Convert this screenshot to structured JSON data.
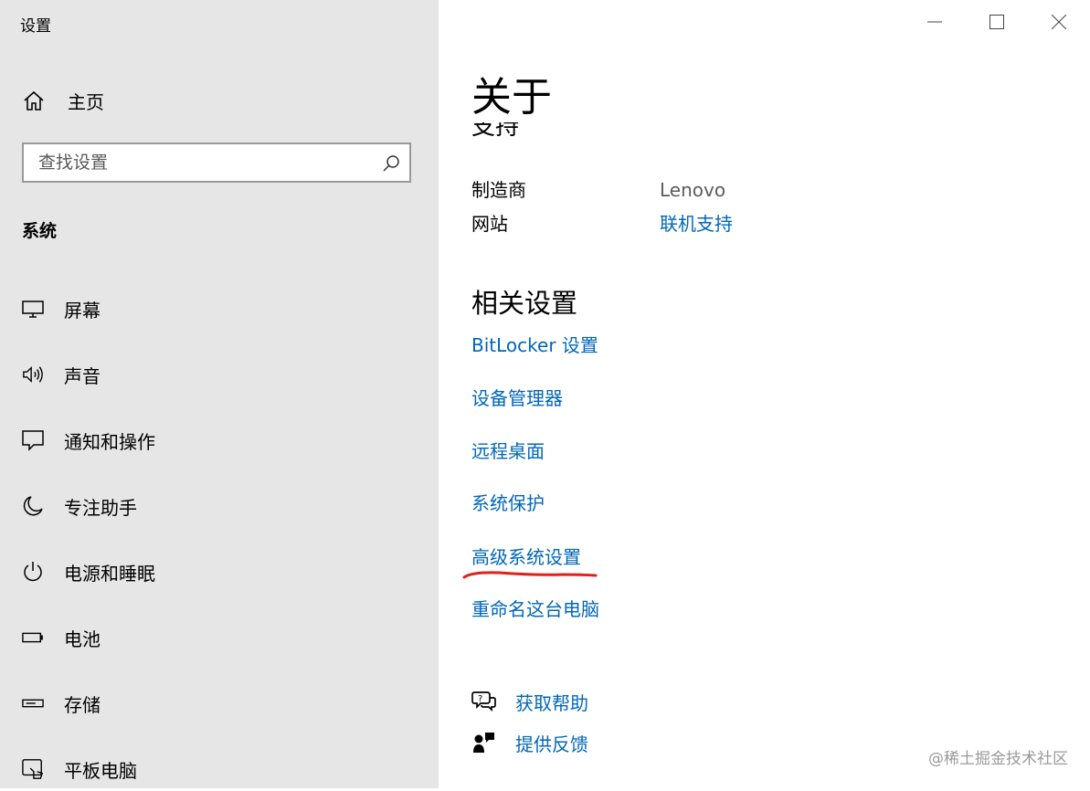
{
  "window": {
    "title": "设置",
    "controls": {
      "minimize": "minimize-icon",
      "maximize": "maximize-icon",
      "close": "close-icon"
    }
  },
  "sidebar": {
    "home_label": "主页",
    "search": {
      "placeholder": "查找设置",
      "value": ""
    },
    "section_heading": "系统",
    "items": [
      {
        "label": "屏幕",
        "icon": "display-icon"
      },
      {
        "label": "声音",
        "icon": "speaker-icon"
      },
      {
        "label": "通知和操作",
        "icon": "notification-icon"
      },
      {
        "label": "专注助手",
        "icon": "moon-icon"
      },
      {
        "label": "电源和睡眠",
        "icon": "power-icon"
      },
      {
        "label": "电池",
        "icon": "battery-icon"
      },
      {
        "label": "存储",
        "icon": "storage-icon"
      },
      {
        "label": "平板电脑",
        "icon": "tablet-icon"
      }
    ]
  },
  "main": {
    "title": "关于",
    "clipped_heading": "支持",
    "support": {
      "manufacturer_label": "制造商",
      "manufacturer_value": "Lenovo",
      "website_label": "网站",
      "website_link": "联机支持"
    },
    "related_settings": {
      "title": "相关设置",
      "links": [
        "BitLocker 设置",
        "设备管理器",
        "远程桌面",
        "系统保护",
        "高级系统设置",
        "重命名这台电脑"
      ]
    },
    "help": {
      "get_help": "获取帮助",
      "give_feedback": "提供反馈"
    }
  },
  "watermark": "@稀土掘金技术社区",
  "colors": {
    "sidebar_bg": "#e6e6e6",
    "link": "#0067b8",
    "annotation_red": "#e0201b"
  }
}
